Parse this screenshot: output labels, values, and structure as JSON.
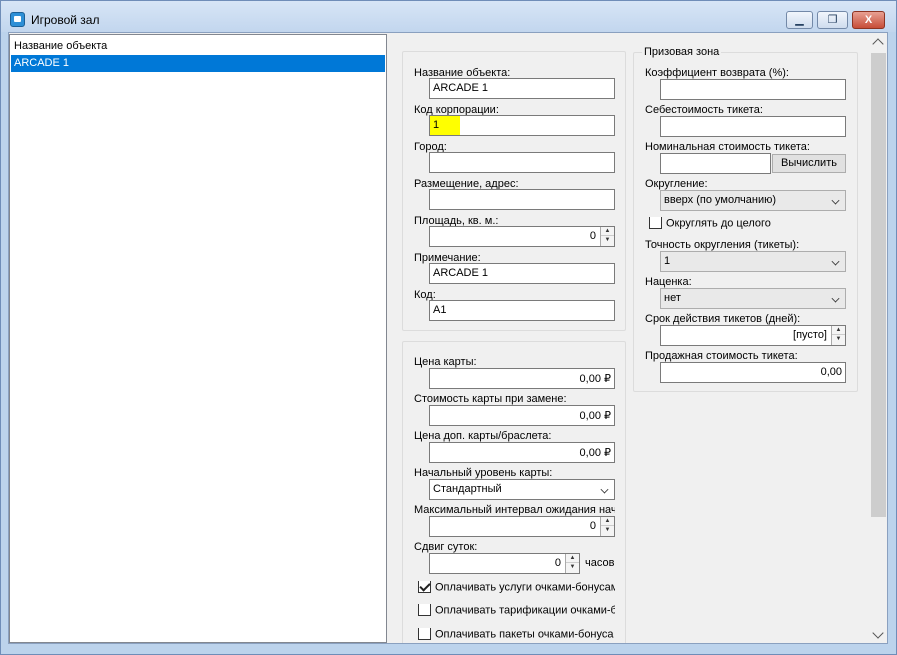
{
  "window": {
    "title": "Игровой зал",
    "minimize": "▁",
    "maximize": "❐",
    "close": "X"
  },
  "list": {
    "header": "Название объекта",
    "items": [
      "ARCADE 1"
    ]
  },
  "object": {
    "name_label": "Название объекта:",
    "name_value": "ARCADE 1",
    "corp_label": "Код корпорации:",
    "corp_value": "1",
    "city_label": "Город:",
    "city_value": "",
    "address_label": "Размещение, адрес:",
    "address_value": "",
    "area_label": "Площадь, кв. м.:",
    "area_value": "0",
    "note_label": "Примечание:",
    "note_value": "ARCADE 1",
    "code_label": "Код:",
    "code_value": "A1"
  },
  "cards": {
    "price_label": "Цена карты:",
    "price_value": "0,00 ₽",
    "replace_label": "Стоимость карты при замене:",
    "replace_value": "0,00 ₽",
    "extra_label": "Цена доп. карты/браслета:",
    "extra_value": "0,00 ₽",
    "level_label": "Начальный уровень карты:",
    "level_value": "Стандартный",
    "maxwait_label": "Максимальный интервал ожидания нач",
    "maxwait_value": "0",
    "shift_label": "Сдвиг суток:",
    "shift_value": "0",
    "shift_unit": "часов",
    "chk1_label": "Оплачивать услуги очками-бонусам",
    "chk1_checked": true,
    "chk2_label": "Оплачивать тарификации очками-б",
    "chk2_checked": false,
    "chk3_label": "Оплачивать пакеты очками-бонуса",
    "chk3_checked": false
  },
  "prize": {
    "title": "Призовая зона",
    "return_label": "Коэффициент возврата (%):",
    "return_value": "",
    "cost_label": "Себестоимость тикета:",
    "cost_value": "",
    "nominal_label": "Номинальная стоимость тикета:",
    "nominal_value": "",
    "calc_button": "Вычислить",
    "rounding_label": "Округление:",
    "rounding_value": "вверх (по умолчанию)",
    "round_whole_label": "Округлять до целого",
    "round_whole_checked": false,
    "precision_label": "Точность округления (тикеты):",
    "precision_value": "1",
    "markup_label": "Наценка:",
    "markup_value": "нет",
    "validity_label": "Срок действия тикетов (дней):",
    "validity_value": "[пусто]",
    "sale_label": "Продажная стоимость тикета:",
    "sale_value": "0,00"
  }
}
